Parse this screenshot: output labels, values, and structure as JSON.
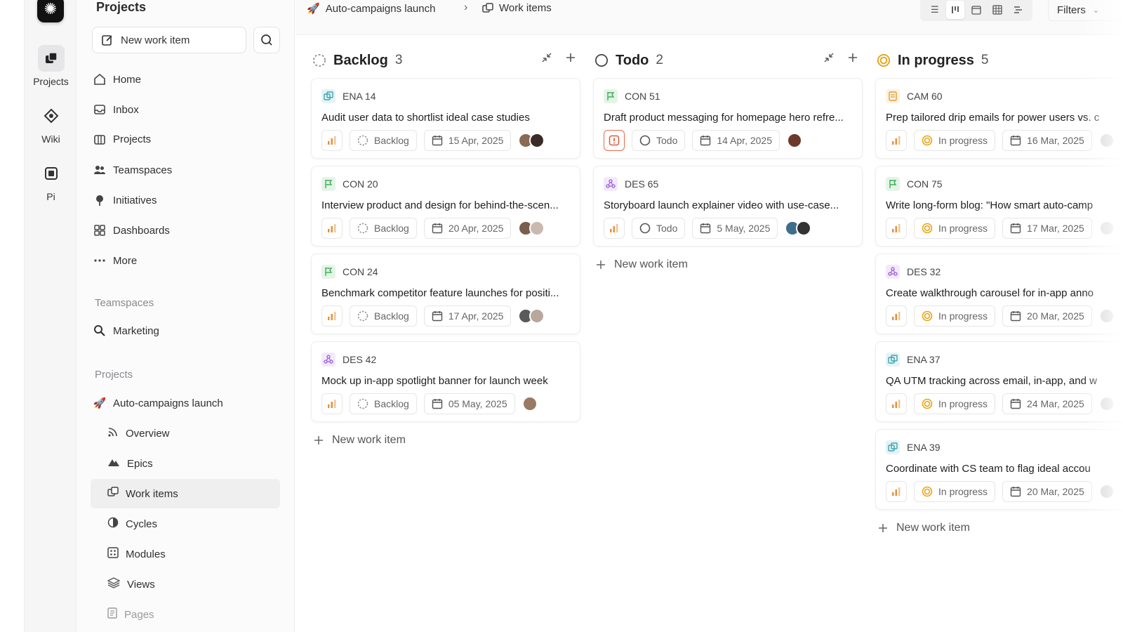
{
  "rail": {
    "items": [
      {
        "label": "Projects",
        "icon": "projects-icon"
      },
      {
        "label": "Wiki",
        "icon": "wiki-icon"
      },
      {
        "label": "Pi",
        "icon": "pi-icon"
      }
    ]
  },
  "sidebar": {
    "title": "Projects",
    "new_work_item": "New work item",
    "nav": [
      "Home",
      "Inbox",
      "Projects",
      "Teamspaces",
      "Initiatives",
      "Dashboards",
      "More"
    ],
    "teamspaces_label": "Teamspaces",
    "teamspaces": [
      "Marketing"
    ],
    "projects_label": "Projects",
    "project_name": "Auto-campaigns launch",
    "project_items": [
      "Overview",
      "Epics",
      "Work items",
      "Cycles",
      "Modules",
      "Views",
      "Pages"
    ]
  },
  "topbar": {
    "crumb_project": "Auto-campaigns launch",
    "crumb_page": "Work items",
    "filters": "Filters"
  },
  "columns": [
    {
      "title": "Backlog",
      "count": "3",
      "new_work_item": "New work item",
      "cards": [
        {
          "id": "ENA 14",
          "tag": "ena",
          "title": "Audit user data to shortlist ideal case studies",
          "state": "Backlog",
          "date": "15 Apr, 2025"
        },
        {
          "id": "CON 20",
          "tag": "con",
          "title": "Interview product and design for behind-the-scen...",
          "state": "Backlog",
          "date": "20 Apr, 2025"
        },
        {
          "id": "CON 24",
          "tag": "con",
          "title": "Benchmark competitor feature launches for positi...",
          "state": "Backlog",
          "date": "17 Apr, 2025"
        },
        {
          "id": "DES 42",
          "tag": "des",
          "title": "Mock up in-app spotlight banner for launch week",
          "state": "Backlog",
          "date": "05 May, 2025"
        }
      ]
    },
    {
      "title": "Todo",
      "count": "2",
      "new_work_item": "New work item",
      "cards": [
        {
          "id": "CON 51",
          "tag": "con",
          "title": "Draft product messaging for homepage hero refre...",
          "state": "Todo",
          "date": "14 Apr, 2025"
        },
        {
          "id": "DES 65",
          "tag": "des",
          "title": "Storyboard launch explainer video with use-case...",
          "state": "Todo",
          "date": "5 May, 2025"
        }
      ]
    },
    {
      "title": "In progress",
      "count": "5",
      "new_work_item": "New work item",
      "cards": [
        {
          "id": "CAM 60",
          "tag": "cam",
          "title": "Prep tailored drip emails for power users vs. c",
          "state": "In progress",
          "date": "16 Mar, 2025"
        },
        {
          "id": "CON 75",
          "tag": "con",
          "title": "Write long-form blog: \"How smart auto-camp",
          "state": "In progress",
          "date": "17 Mar, 2025"
        },
        {
          "id": "DES 32",
          "tag": "des",
          "title": "Create walkthrough carousel for in-app anno",
          "state": "In progress",
          "date": "20 Mar, 2025"
        },
        {
          "id": "ENA 37",
          "tag": "ena",
          "title": "QA UTM tracking across email, in-app, and w",
          "state": "In progress",
          "date": "24 Mar, 2025"
        },
        {
          "id": "ENA 39",
          "tag": "ena",
          "title": "Coordinate with CS team to flag ideal accou",
          "state": "In progress",
          "date": "20 Mar, 2025"
        }
      ]
    }
  ],
  "colors": {
    "ena": "#3aa5b0",
    "con": "#3fae54",
    "des": "#9a5bd6",
    "cam": "#e0a030",
    "progress": "#e8a417",
    "priority_bar": "#e8903a",
    "urgent": "#e0583a"
  }
}
